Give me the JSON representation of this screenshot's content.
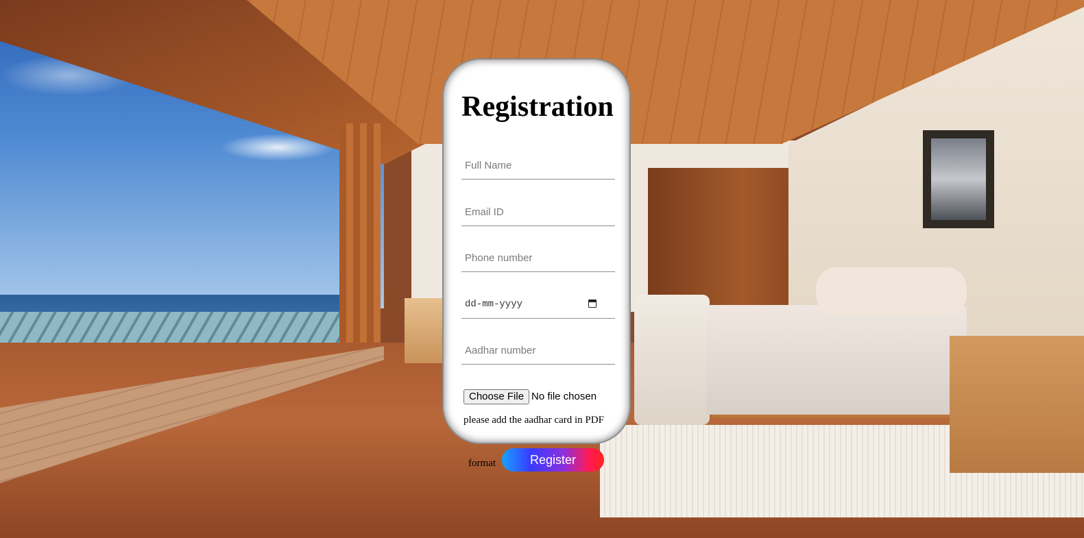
{
  "form": {
    "title": "Registration",
    "fields": {
      "full_name_placeholder": "Full Name",
      "email_placeholder": "Email ID",
      "phone_placeholder": "Phone number",
      "date_placeholder": "dd-mm-yyyy",
      "aadhar_placeholder": "Aadhar number"
    },
    "file_input": {
      "button_label": "Choose File",
      "status": "No file chosen"
    },
    "hint_line1": "please add the aadhar card in PDF",
    "hint_line2": "format",
    "submit_label": "Register"
  },
  "colors": {
    "card_background": "#ffffff",
    "button_gradient": [
      "#17a2ff",
      "#3a3bff",
      "#8a2fe0",
      "#ff1a55",
      "#ff2222"
    ]
  }
}
